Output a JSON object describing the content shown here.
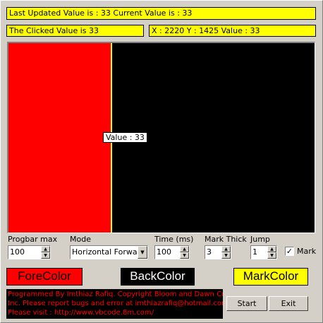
{
  "status": {
    "last_updated": "Last Updated Value is : 33 Current Value is : 33",
    "clicked": "The Clicked Value is  33",
    "coords": "X : 2220 Y : 1425 Value : 33"
  },
  "progress": {
    "value": 33,
    "max": 100,
    "tooltip": "Value : 33",
    "fore_color": "#ff0000",
    "back_color": "#000000",
    "mark_color": "#ffff00"
  },
  "controls": {
    "progbar_max_label": "Progbar max",
    "progbar_max_value": "100",
    "mode_label": "Mode",
    "mode_value": "Horizontal Forward",
    "time_label": "Time (ms)",
    "time_value": "100",
    "mark_thick_label": "Mark Thick",
    "mark_thick_value": "3",
    "jump_label": "Jump",
    "jump_value": "1",
    "mark_label": "Mark",
    "mark_checked": true
  },
  "buttons": {
    "fore_color": "ForeColor",
    "back_color": "BackColor",
    "mark_color": "MarkColor",
    "start": "Start",
    "exit": "Exit"
  },
  "credits": {
    "line1": "Programmed By Imthiaz Rafiq. Copyright Bloom and Dawn Corp",
    "line2": "Inc. Please report bugs and error at imthiazrafiq@hotmail.com",
    "line3": "Please visit : http://www.vbcode.8m.com/"
  },
  "icons": {
    "spin_up": "spin-up-icon",
    "spin_down": "spin-down-icon",
    "dropdown": "chevron-down-icon",
    "check": "checkmark-icon"
  }
}
